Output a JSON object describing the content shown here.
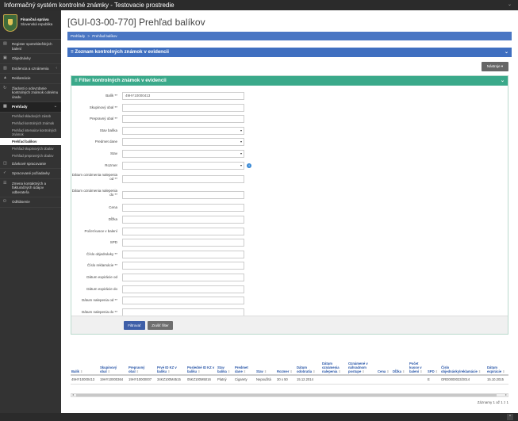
{
  "app": {
    "title": "Informačný systém kontrolné známky - Testovacie prostredie"
  },
  "brand": {
    "name": "Finančná správa",
    "country": "Slovenská republika"
  },
  "sidebar": {
    "items": [
      {
        "label": "Register spotrebiteľských balení",
        "icon": "list-icon"
      },
      {
        "label": "Objednávky",
        "icon": "cart-icon"
      },
      {
        "label": "Evidencia a oznámenia",
        "icon": "document-icon",
        "arrow": "‹"
      },
      {
        "label": "Reklamácie",
        "icon": "warning-icon"
      },
      {
        "label": "Žiadosti o odovzdanie kontrolných známok colnému úradu",
        "icon": "sync-icon"
      },
      {
        "label": "Prehľady",
        "icon": "chart-icon",
        "arrow": "⌄",
        "active": true
      }
    ],
    "subitems": [
      {
        "label": "Prehľad skladových zásob"
      },
      {
        "label": "Prehľad kontrolných známok"
      },
      {
        "label": "Prehľad intervalov kontrolných známok"
      },
      {
        "label": "Prehľad balíkov",
        "active": true
      },
      {
        "label": "Prehľad skupinových obalov"
      },
      {
        "label": "Prehľad prepravných obalov"
      }
    ],
    "items_after": [
      {
        "label": "Dávkové spracovanie",
        "icon": "batch-icon"
      },
      {
        "label": "Spracované požiadavky",
        "icon": "check-icon"
      },
      {
        "label": "Zmena kontaktných a fakturačných údajov odberateľa",
        "icon": "user-icon"
      },
      {
        "label": "Odhlásenie",
        "icon": "logout-icon"
      }
    ]
  },
  "page": {
    "title": "[GUI-03-00-770] Prehľad balíkov"
  },
  "breadcrumb": {
    "items": [
      "Prehľady",
      "Prehľad balíkov"
    ],
    "separator": ">"
  },
  "panel": {
    "title": "Zoznam kontrolných známok v evidencii",
    "collapse": "⌄"
  },
  "tools": {
    "label": "Nástroje ▾"
  },
  "filter": {
    "title": "Filter kontrolných známok v evidencii",
    "collapse": "⌄",
    "fields": [
      {
        "label": "Balík **",
        "value": "49HY10000413",
        "type": "text"
      },
      {
        "label": "Skupinový obal **",
        "value": "",
        "type": "text"
      },
      {
        "label": "Prepravný obal **",
        "value": "",
        "type": "text"
      },
      {
        "label": "Stav balíka",
        "value": "",
        "type": "select"
      },
      {
        "label": "Predmet dane",
        "value": "",
        "type": "select"
      },
      {
        "label": "Stav",
        "value": "",
        "type": "select"
      },
      {
        "label": "Rozmer",
        "value": "",
        "type": "select",
        "info": "i"
      },
      {
        "label": "Dátum oznámenia nalepenia od **",
        "value": "",
        "type": "text",
        "tall": true
      },
      {
        "label": "Dátum oznámenia nalepenia do **",
        "value": "",
        "type": "text",
        "tall": true
      },
      {
        "label": "Cena",
        "value": "",
        "type": "text"
      },
      {
        "label": "Dĺžka",
        "value": "",
        "type": "text"
      },
      {
        "label": "Počet kusov v balení",
        "value": "",
        "type": "text"
      },
      {
        "label": "SPD",
        "value": "",
        "type": "text"
      },
      {
        "label": "Číslo objednávky **",
        "value": "",
        "type": "text"
      },
      {
        "label": "Číslo reklamácie **",
        "value": "",
        "type": "text"
      },
      {
        "label": "Dátum expirácie od",
        "value": "",
        "type": "text"
      },
      {
        "label": "Dátum expirácie do",
        "value": "",
        "type": "text"
      },
      {
        "label": "Dátum nalepenia od **",
        "value": "",
        "type": "text"
      },
      {
        "label": "Dátum nalepenia do **",
        "value": "",
        "type": "text"
      }
    ],
    "apply_label": "Filtrovať",
    "cancel_label": "Zrušiť filter"
  },
  "table": {
    "columns": [
      "Balík",
      "Skupinový obal",
      "Prepravný obal",
      "Prvé ID KZ v balíku",
      "Posledné ID KZ v balíku",
      "Stav balíka",
      "Predmet dane",
      "Stav",
      "Rozmer",
      "Dátum odobratia",
      "Dátum oznámenia nalepenia",
      "Oznámené v náhradnom postupe",
      "Cena",
      "Dĺžka",
      "Počet kusov v balení",
      "SPD",
      "Číslo objednávky/reklamácie",
      "Dátum expirácie"
    ],
    "sort_glyph": "⇕",
    "rows": [
      [
        "49HY10000413",
        "19HY10000364",
        "19HY10000007",
        "34KZ100M4515",
        "05KZ100M5016",
        "Platný",
        "Cigarety",
        "Nepoužitá",
        "30 x 50",
        "15.12.2014",
        "",
        "",
        "",
        "",
        "",
        "E",
        "ORD0000023/2014",
        "15.10.2015"
      ]
    ]
  },
  "records": {
    "label": "Záznamy 1 až 1 z 1"
  },
  "scroll": {
    "left": "◂",
    "right": "▸"
  },
  "back_to_top": {
    "label": "⌃"
  }
}
